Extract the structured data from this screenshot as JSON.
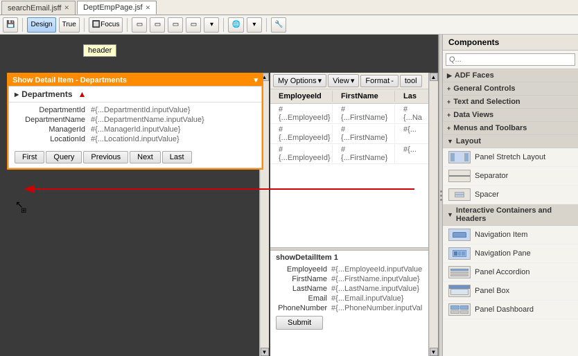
{
  "tabs": [
    {
      "id": "tab1",
      "label": "searchEmail.jsff",
      "active": false
    },
    {
      "id": "tab2",
      "label": "DeptEmpPage.jsf",
      "active": true
    }
  ],
  "toolbar": {
    "design_label": "Design",
    "true_label": "True",
    "focus_label": "Focus"
  },
  "canvas": {
    "header_tooltip": "header",
    "show_detail_title": "Show Detail Item - Departments",
    "dept_title": "Departments",
    "dept_rows": [
      {
        "label": "DepartmentId",
        "value": "#{...DepartmentId.inputValue}"
      },
      {
        "label": "DepartmentName",
        "value": "#{...DepartmentName.inputValue}"
      },
      {
        "label": "ManagerId",
        "value": "#{...ManagerId.inputValue}"
      },
      {
        "label": "LocationId",
        "value": "#{...LocationId.inputValue}"
      }
    ],
    "dept_buttons": [
      "First",
      "Query",
      "Previous",
      "Next",
      "Last"
    ],
    "table_toolbar": {
      "my_options": "My Options",
      "view": "View",
      "format": "Format",
      "tool": "tool"
    },
    "table_headers": [
      "EmployeeId",
      "FirstName",
      "Las"
    ],
    "table_rows": [
      [
        "#{...EmployeeId}",
        "#{...FirstName}",
        "#{...Na"
      ],
      [
        "#{...EmployeeId}",
        "#{...FirstName}",
        "#{..."
      ],
      [
        "#{...EmployeeId}",
        "#{...FirstName}",
        "#{..."
      ]
    ],
    "show_detail_1_title": "showDetailItem 1",
    "form_rows": [
      {
        "label": "EmployeeId",
        "value": "#{...EmployeeId.inputValue"
      },
      {
        "label": "FirstName",
        "value": "#{...FirstName.inputValue}"
      },
      {
        "label": "LastName",
        "value": "#{...LastName.inputValue}"
      },
      {
        "label": "Email",
        "value": "#{...Email.inputValue}"
      },
      {
        "label": "PhoneNumber",
        "value": "#{...PhoneNumber.inputVal"
      }
    ],
    "submit_label": "Submit"
  },
  "components": {
    "panel_title": "Components",
    "search_placeholder": "Q...",
    "sections": [
      {
        "id": "adf-faces",
        "label": "ADF Faces",
        "expanded": true,
        "items": []
      },
      {
        "id": "general-controls",
        "label": "General Controls",
        "expanded": false,
        "items": []
      },
      {
        "id": "text-and-selection",
        "label": "Text and Selection",
        "expanded": false,
        "items": []
      },
      {
        "id": "data-views",
        "label": "Data Views",
        "expanded": false,
        "items": []
      },
      {
        "id": "menus-and-toolbars",
        "label": "Menus and Toolbars",
        "expanded": false,
        "items": []
      },
      {
        "id": "layout",
        "label": "Layout",
        "expanded": true,
        "items": [
          {
            "label": "Panel Stretch Layout",
            "icon": "stretch"
          },
          {
            "label": "Separator",
            "icon": "separator"
          },
          {
            "label": "Spacer",
            "icon": "spacer"
          }
        ]
      },
      {
        "id": "interactive-containers",
        "label": "Interactive Containers and Headers",
        "expanded": true,
        "items": [
          {
            "label": "Navigation Item",
            "icon": "nav-item"
          },
          {
            "label": "Navigation Pane",
            "icon": "nav-pane"
          },
          {
            "label": "Panel Accordion",
            "icon": "accordion"
          },
          {
            "label": "Panel Box",
            "icon": "panel-box"
          },
          {
            "label": "Panel Dashboard",
            "icon": "dashboard"
          }
        ]
      }
    ]
  }
}
